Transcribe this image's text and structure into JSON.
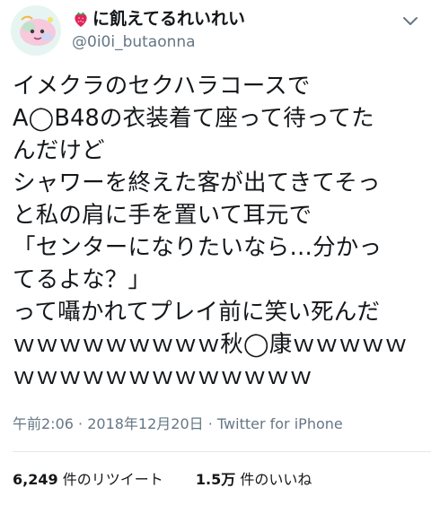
{
  "tweet": {
    "display_name": "に飢えてるれいれい",
    "handle": "@0i0i_butaonna",
    "text_lines": [
      "イメクラのセクハラコースで",
      "A◯B48の衣装着て座って待ってた",
      "んだけど",
      "シャワーを終えた客が出てきてそっ",
      "と私の肩に手を置いて耳元で",
      "「センターになりたいなら…分かっ",
      "てるよな？」",
      "って囁かれてプレイ前に笑い死んだ",
      "ｗｗｗｗｗｗｗｗｗ秋◯康ｗｗｗｗｗ",
      "ｗｗｗｗｗｗｗｗｗｗｗｗｗ"
    ],
    "time": "午前2:06",
    "date": "2018年12月20日",
    "source": "Twitter for iPhone",
    "retweets_count": "6,249",
    "retweets_label": "件のリツイート",
    "likes_count": "1.5万",
    "likes_label": "件のいいね",
    "icons": {
      "avatar": "avatar-illustration",
      "name_prefix": "strawberry-icon",
      "menu": "chevron-down-icon"
    },
    "colors": {
      "text": "#14171a",
      "secondary": "#657786",
      "strawberry": "#e0245e"
    }
  }
}
